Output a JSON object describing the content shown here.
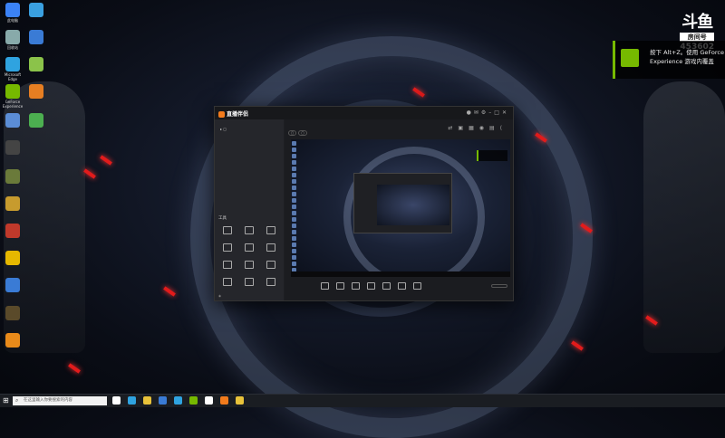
{
  "desktop": {
    "icons": [
      {
        "label": "此电脑",
        "icon": "computer-icon",
        "color": "#3b82f6"
      },
      {
        "label": "回收站",
        "icon": "recycle-bin-icon",
        "color": "#8aa"
      },
      {
        "label": "Microsoft Edge",
        "icon": "edge-icon",
        "color": "#2fa3e0"
      },
      {
        "label": "GeForce Experience",
        "icon": "geforce-icon",
        "color": "#76b900"
      },
      {
        "label": "",
        "icon": "app-icon",
        "color": "#5b8dd6"
      },
      {
        "label": "",
        "icon": "app-icon",
        "color": "#444"
      },
      {
        "label": "",
        "icon": "app-icon",
        "color": "#6a7a3a"
      },
      {
        "label": "",
        "icon": "app-icon",
        "color": "#c79b2e"
      },
      {
        "label": "",
        "icon": "app-icon",
        "color": "#c0392b"
      },
      {
        "label": "",
        "icon": "app-icon",
        "color": "#e6b800"
      },
      {
        "label": "",
        "icon": "app-icon",
        "color": "#3a7bd5"
      },
      {
        "label": "",
        "icon": "app-icon",
        "color": "#5a4a2a"
      },
      {
        "label": "",
        "icon": "app-icon",
        "color": "#e88a1a"
      }
    ],
    "icons_col2": [
      {
        "label": "",
        "icon": "app-icon",
        "color": "#3aa0e0"
      },
      {
        "label": "",
        "icon": "app-icon",
        "color": "#3a7bd5"
      },
      {
        "label": "",
        "icon": "app-icon",
        "color": "#8bc34a"
      },
      {
        "label": "",
        "icon": "app-icon",
        "color": "#e67e22"
      },
      {
        "label": "",
        "icon": "app-icon",
        "color": "#4caf50"
      }
    ]
  },
  "overlay": {
    "douyu_logo": "斗鱼",
    "room_label": "房间号",
    "room_number": "453602",
    "nvidia_text": "按下 Alt+Z。使用 GeForce Experience 游戏内覆盖"
  },
  "app": {
    "title": "直播伴侣",
    "version": "",
    "tabs": [
      "",
      "",
      "",
      ""
    ],
    "tools_heading": "工具",
    "tools": [
      {
        "label": "",
        "icon": "tool-icon"
      },
      {
        "label": "",
        "icon": "tool-icon"
      },
      {
        "label": "",
        "icon": "tool-icon"
      },
      {
        "label": "",
        "icon": "tool-icon"
      },
      {
        "label": "",
        "icon": "tool-icon"
      },
      {
        "label": "",
        "icon": "tool-icon"
      },
      {
        "label": "",
        "icon": "tool-icon"
      },
      {
        "label": "",
        "icon": "tool-icon"
      },
      {
        "label": "",
        "icon": "tool-icon"
      },
      {
        "label": "",
        "icon": "tool-icon"
      },
      {
        "label": "",
        "icon": "tool-icon"
      },
      {
        "label": "",
        "icon": "tool-icon"
      }
    ],
    "bottom_items": [
      {
        "label": "",
        "icon": "scene-icon"
      },
      {
        "label": "",
        "icon": "camera-icon"
      },
      {
        "label": "",
        "icon": "window-icon"
      },
      {
        "label": "",
        "icon": "capture-icon"
      },
      {
        "label": "",
        "icon": "text-icon"
      },
      {
        "label": "",
        "icon": "image-icon"
      },
      {
        "label": "",
        "icon": "audio-icon"
      }
    ],
    "start_button": ""
  },
  "taskbar": {
    "start": "⊞",
    "search_placeholder": "在这里输入你要搜索的内容",
    "pinned_colors": [
      "#ffffff",
      "#2fa3e0",
      "#e8c23a",
      "#3a7bd5",
      "#2fa3e0",
      "#76b900",
      "#ffffff",
      "#f27b1c",
      "#e8c23a"
    ],
    "clock_time": "",
    "clock_date": ""
  }
}
